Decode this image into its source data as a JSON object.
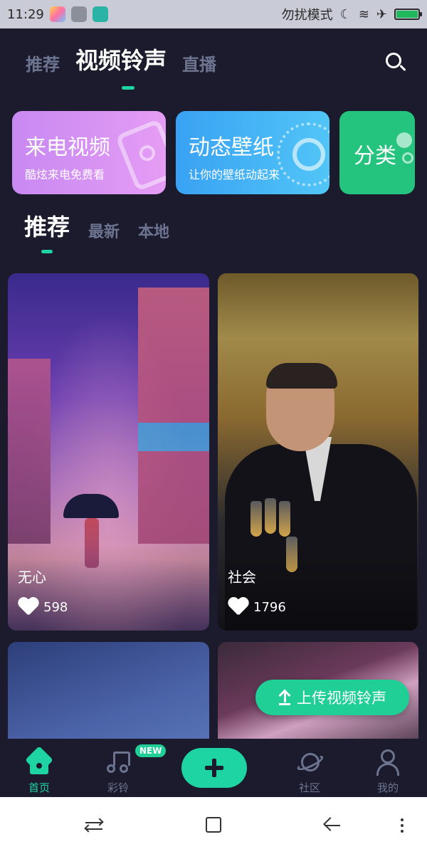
{
  "status_bar": {
    "time": "11:29",
    "dnd_label": "勿扰模式",
    "battery_percent": 100
  },
  "top_tabs": [
    {
      "label": "推荐",
      "active": false
    },
    {
      "label": "视频铃声",
      "active": true
    },
    {
      "label": "直播",
      "active": false
    }
  ],
  "feature_cards": [
    {
      "title": "来电视频",
      "subtitle": "酷炫来电免费看",
      "color": "#d590f3"
    },
    {
      "title": "动态壁纸",
      "subtitle": "让你的壁纸动起来",
      "color": "#45b4f5"
    },
    {
      "title": "分类",
      "subtitle": "",
      "color": "#24c47e"
    }
  ],
  "sub_tabs": [
    {
      "label": "推荐",
      "active": true
    },
    {
      "label": "最新",
      "active": false
    },
    {
      "label": "本地",
      "active": false
    }
  ],
  "videos": [
    {
      "title": "无心",
      "likes": "598"
    },
    {
      "title": "社会",
      "likes": "1796"
    },
    {
      "title": "",
      "likes": ""
    },
    {
      "title": "",
      "likes": ""
    }
  ],
  "upload_button": {
    "label": "上传视频铃声"
  },
  "bottom_nav": {
    "items": [
      {
        "label": "首页",
        "icon": "home-icon",
        "active": true
      },
      {
        "label": "彩铃",
        "icon": "music-icon",
        "active": false,
        "badge": "NEW"
      },
      {
        "label": "",
        "icon": "plus-icon",
        "active": false
      },
      {
        "label": "社区",
        "icon": "planet-icon",
        "active": false
      },
      {
        "label": "我的",
        "icon": "user-icon",
        "active": false
      }
    ]
  },
  "colors": {
    "background": "#1b1b2d",
    "accent": "#1fd4a3",
    "inactive_text": "#6c7490"
  }
}
